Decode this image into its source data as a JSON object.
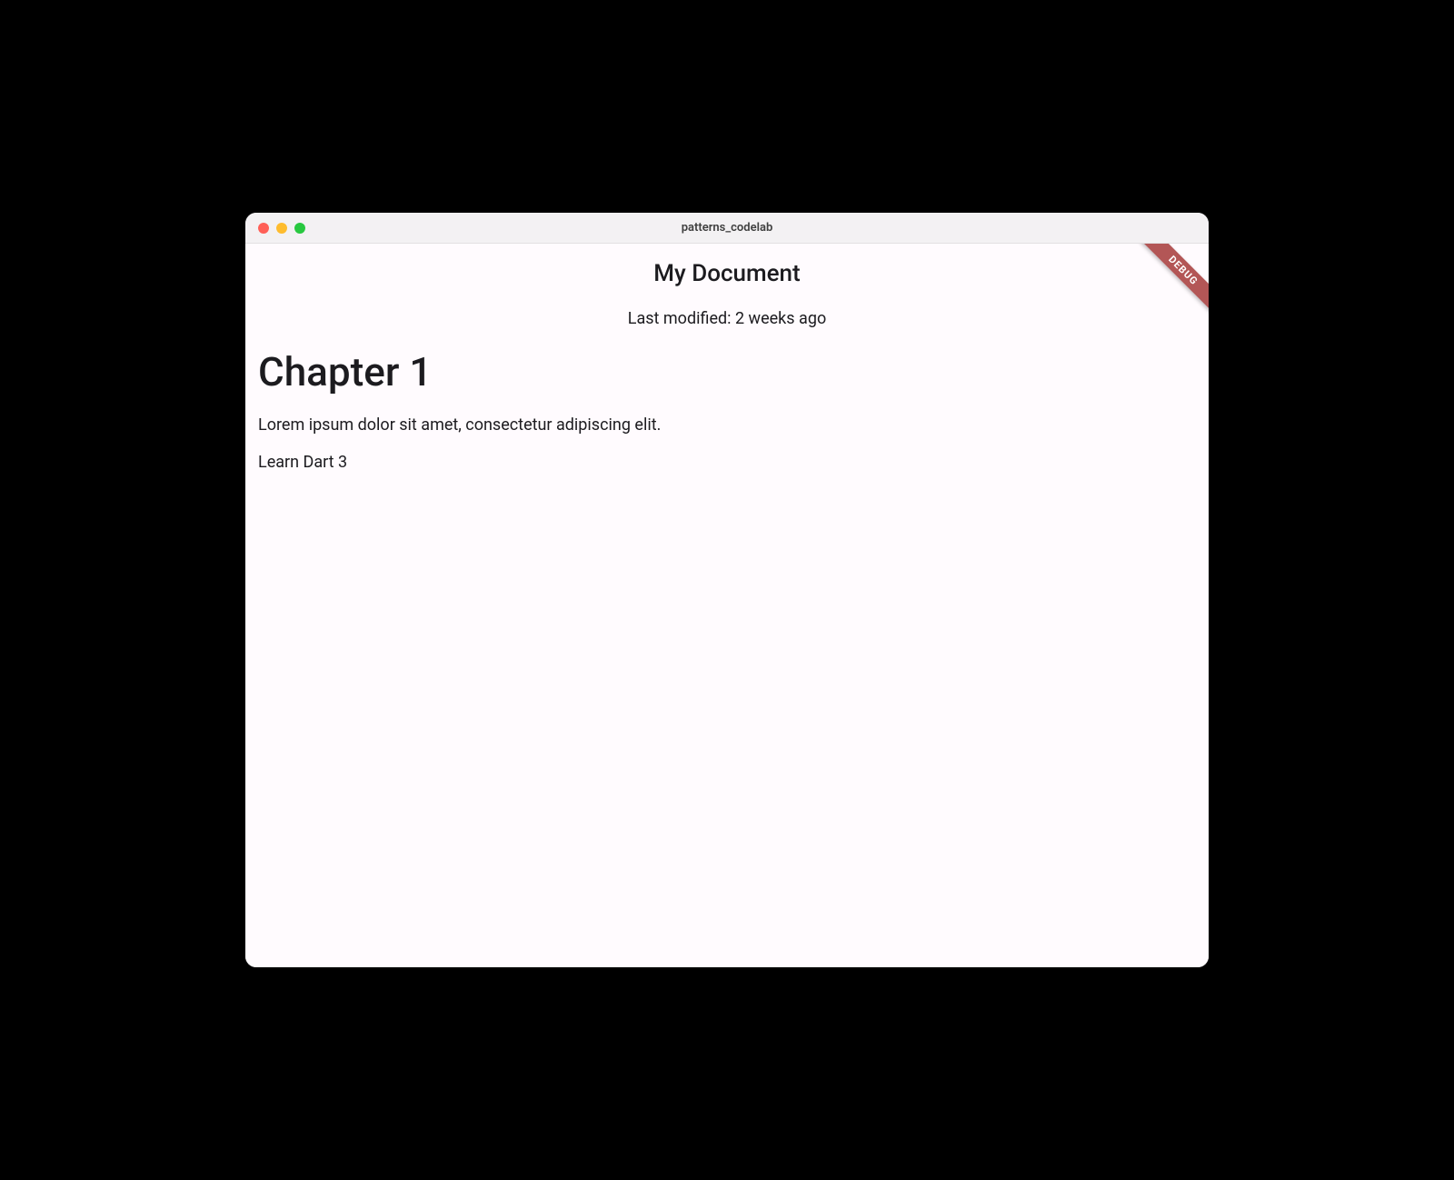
{
  "window": {
    "title": "patterns_codelab"
  },
  "debug_banner": "DEBUG",
  "document": {
    "title": "My Document",
    "last_modified": "Last modified: 2 weeks ago",
    "blocks": [
      {
        "type": "h1",
        "text": "Chapter 1"
      },
      {
        "type": "p",
        "text": "Lorem ipsum dolor sit amet, consectetur adipiscing elit."
      },
      {
        "type": "p",
        "text": "Learn Dart 3"
      }
    ]
  }
}
